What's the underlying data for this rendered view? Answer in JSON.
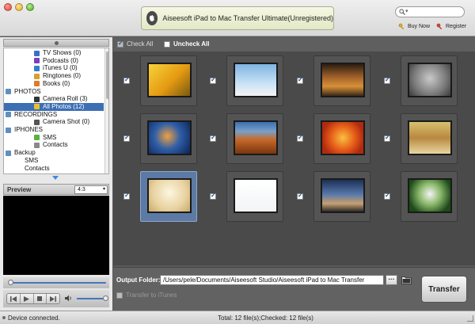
{
  "window": {
    "title": "Aiseesoft iPad to Mac Transfer Ultimate(Unregistered)",
    "buy_now": "Buy Now",
    "register": "Register",
    "search_placeholder": ""
  },
  "tree": {
    "items": [
      {
        "label": "TV Shows (0)",
        "type": "child",
        "color": "#3a6fc9"
      },
      {
        "label": "Podcasts (0)",
        "type": "child",
        "color": "#7a3fc0"
      },
      {
        "label": "iTunes U (0)",
        "type": "child",
        "color": "#2f7fd0"
      },
      {
        "label": "Ringtones (0)",
        "type": "child",
        "color": "#d8a02a"
      },
      {
        "label": "Books (0)",
        "type": "child",
        "color": "#e07a2a"
      },
      {
        "label": "PHOTOS",
        "type": "group",
        "color": "#5f8fbf"
      },
      {
        "label": "Camera Roll (3)",
        "type": "child",
        "color": "#333333"
      },
      {
        "label": "All Photos (12)",
        "type": "child",
        "color": "#e8c030",
        "selected": true
      },
      {
        "label": "RECORDINGS",
        "type": "group",
        "color": "#5f8fbf"
      },
      {
        "label": "Camera Shot (0)",
        "type": "child",
        "color": "#555555"
      },
      {
        "label": "IPHONES",
        "type": "group",
        "color": "#5f8fbf"
      },
      {
        "label": "SMS",
        "type": "child",
        "color": "#5ab040"
      },
      {
        "label": "Contacts",
        "type": "child",
        "color": "#8a8a8a"
      },
      {
        "label": "Backup",
        "type": "group",
        "color": "#5f8fbf"
      },
      {
        "label": "SMS",
        "type": "sub",
        "color": ""
      },
      {
        "label": "Contacts",
        "type": "sub",
        "color": ""
      }
    ]
  },
  "preview": {
    "label": "Preview",
    "ratio": "4:3"
  },
  "toolbar": {
    "check_all": "Check All",
    "uncheck_all": "Uncheck All"
  },
  "photos": [
    {
      "name": "yellow-tulips",
      "checked": true,
      "bg": "linear-gradient(135deg,#f7d23a,#e59a12 55%,#7a5a10)"
    },
    {
      "name": "penguins",
      "checked": true,
      "bg": "linear-gradient(#7fb4e2,#c8e2f4 60%,#f4f4f4)"
    },
    {
      "name": "lighthouse",
      "checked": true,
      "bg": "linear-gradient(#2b1e12,#a0602a 40%,#d89038 70%,#3a2a18)"
    },
    {
      "name": "koala",
      "checked": true,
      "bg": "radial-gradient(circle at 50% 45%,#c9c9c9,#7a7a7a 60%,#3b3b3b)"
    },
    {
      "name": "jellyfish",
      "checked": true,
      "bg": "radial-gradient(circle at 45% 45%,#f0a040,#2f5fa8 45%,#0c2250)"
    },
    {
      "name": "desert",
      "checked": true,
      "bg": "linear-gradient(#3b6fb0,#7aa0c8 30%,#c66a2a 55%,#7a3410)"
    },
    {
      "name": "chrysanthemum",
      "checked": true,
      "bg": "radial-gradient(circle,#f8c040,#e8601a 45%,#b02a10 80%)"
    },
    {
      "name": "kittens",
      "checked": true,
      "bg": "linear-gradient(#d8c070,#b88840 50%,#e8d6a0)"
    },
    {
      "name": "coffee-cream",
      "checked": true,
      "bg": "radial-gradient(circle at 50% 40%,#fdf6e0,#e8d2a0 60%,#c8a868)"
    },
    {
      "name": "dolphin",
      "checked": true,
      "bg": "linear-gradient(#ffffff,#f2f4f6)"
    },
    {
      "name": "bridge",
      "checked": true,
      "bg": "linear-gradient(#1d2f55,#5577aa 45%,#c8a070 75%,#2a2a2a)"
    },
    {
      "name": "white-flower",
      "checked": true,
      "bg": "radial-gradient(circle at 50% 45%,#f4f4f4,#8ab86a 40%,#1e4a1a 80%)"
    }
  ],
  "selected_photo_index": 8,
  "output": {
    "label": "Output Folder:",
    "path": "/Users/pele/Documents/Aiseesoft Studio/Aiseesoft iPad to Mac Transfer",
    "browse": "···",
    "to_itunes": "Transfer to iTunes",
    "transfer": "Transfer"
  },
  "status": {
    "left": "Device connected.",
    "center": "Total: 12 file(s);Checked: 12 file(s)"
  }
}
